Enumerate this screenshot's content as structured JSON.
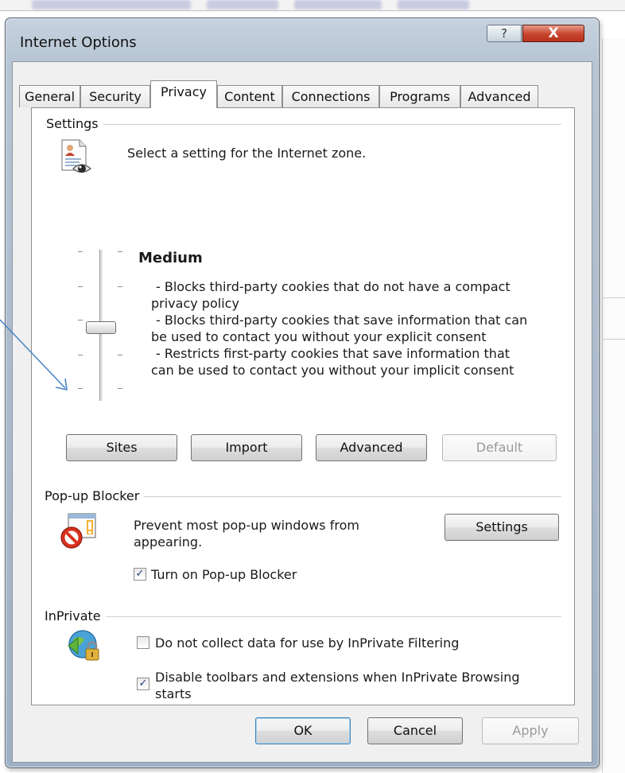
{
  "window": {
    "title": "Internet Options",
    "help_label": "?",
    "close_label": "X"
  },
  "tabs": [
    {
      "label": "General",
      "active": false
    },
    {
      "label": "Security",
      "active": false
    },
    {
      "label": "Privacy",
      "active": true
    },
    {
      "label": "Content",
      "active": false
    },
    {
      "label": "Connections",
      "active": false
    },
    {
      "label": "Programs",
      "active": false
    },
    {
      "label": "Advanced",
      "active": false
    }
  ],
  "settings": {
    "group_label": "Settings",
    "zone_text": "Select a setting for the Internet zone.",
    "level_name": "Medium",
    "description_lines": [
      "- Blocks third-party cookies that do not have a compact",
      "privacy policy",
      "- Blocks third-party cookies that save information that can",
      "be used to contact you without your explicit consent",
      "- Restricts first-party cookies that save information that",
      "can be used to contact you without your implicit consent"
    ],
    "slider_level": 0.5,
    "buttons": {
      "sites": "Sites",
      "import": "Import",
      "advanced": "Advanced",
      "default": "Default"
    }
  },
  "popup_blocker": {
    "group_label": "Pop-up Blocker",
    "text_line1": "Prevent most pop-up windows from",
    "text_line2": "appearing.",
    "settings_button": "Settings",
    "turn_on_label": "Turn on Pop-up Blocker",
    "turn_on_checked": true
  },
  "inprivate": {
    "group_label": "InPrivate",
    "no_collect_label": "Do not collect data for use by InPrivate Filtering",
    "no_collect_checked": false,
    "disable_toolbars_line1": "Disable toolbars and extensions when InPrivate Browsing",
    "disable_toolbars_line2": "starts",
    "disable_toolbars_checked": true
  },
  "footer": {
    "ok": "OK",
    "cancel": "Cancel",
    "apply": "Apply"
  },
  "colors": {
    "close_button": "#c8442c",
    "annotation_arrow": "#4a86c5",
    "checkmark": "#1d3f7c"
  }
}
